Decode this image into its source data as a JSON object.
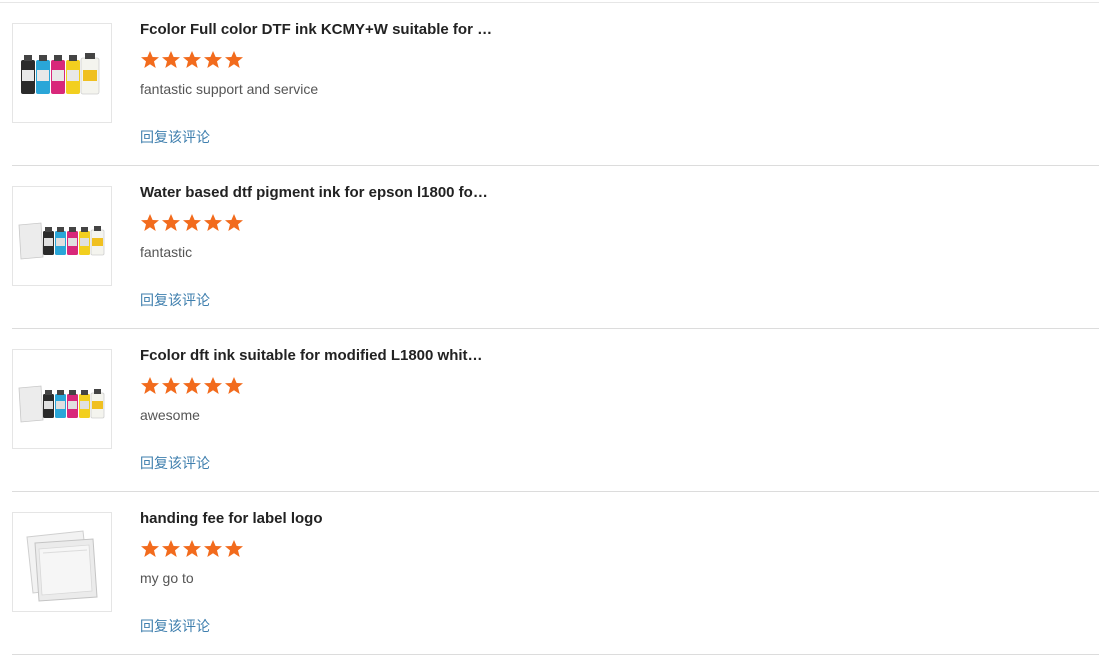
{
  "reviews": [
    {
      "product_title": "Fcolor Full color DTF ink KCMY+W suitable for …",
      "product_image": "ink-bottles-kcmyw",
      "rating": 5,
      "rating_max": 5,
      "comment": "fantastic support and service",
      "reply_label": "回复该评论"
    },
    {
      "product_title": "Water based dtf pigment ink for epson l1800 fo…",
      "product_image": "powder-bag-and-ink-bottles",
      "rating": 5,
      "rating_max": 5,
      "comment": "fantastic",
      "reply_label": "回复该评论"
    },
    {
      "product_title": "Fcolor dft ink suitable for modified L1800 whit…",
      "product_image": "powder-bag-and-ink-bottles",
      "rating": 5,
      "rating_max": 5,
      "comment": "awesome",
      "reply_label": "回复该评论"
    },
    {
      "product_title": "handing fee for label logo",
      "product_image": "clear-plastic-bags",
      "rating": 5,
      "rating_max": 5,
      "comment": "my go to",
      "reply_label": "回复该评论"
    }
  ],
  "colors": {
    "star": "#f26b1d",
    "reply_link": "#3f7fae",
    "title": "#222222",
    "comment": "#555555",
    "divider": "#dcdcdc"
  }
}
